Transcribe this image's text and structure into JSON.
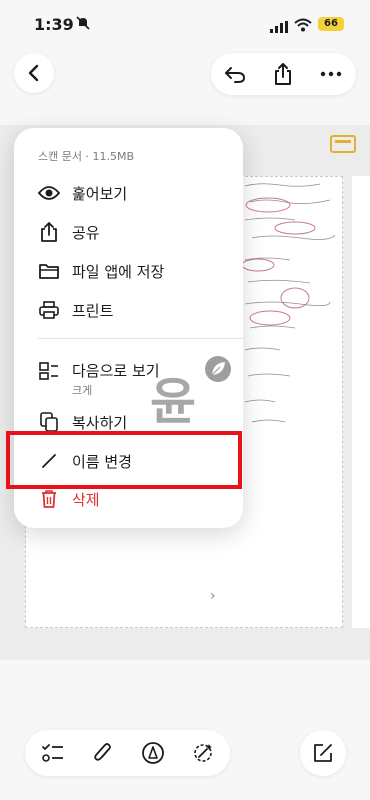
{
  "status": {
    "time": "1:39",
    "battery": "66"
  },
  "menu": {
    "header": "스캔 문서 · 11.5MB",
    "items": [
      {
        "label": "훑어보기"
      },
      {
        "label": "공유"
      },
      {
        "label": "파일 앱에 저장"
      },
      {
        "label": "프린트"
      },
      {
        "label": "다음으로 보기",
        "sub": "크게"
      },
      {
        "label": "복사하기"
      },
      {
        "label": "이름 변경"
      },
      {
        "label": "삭제"
      }
    ]
  },
  "watermark": {
    "text": "윤"
  },
  "colors": {
    "highlight": "#e8121b",
    "delete": "#e0312e",
    "battery": "#f4d13b",
    "scan_badge": "#e0b030"
  }
}
